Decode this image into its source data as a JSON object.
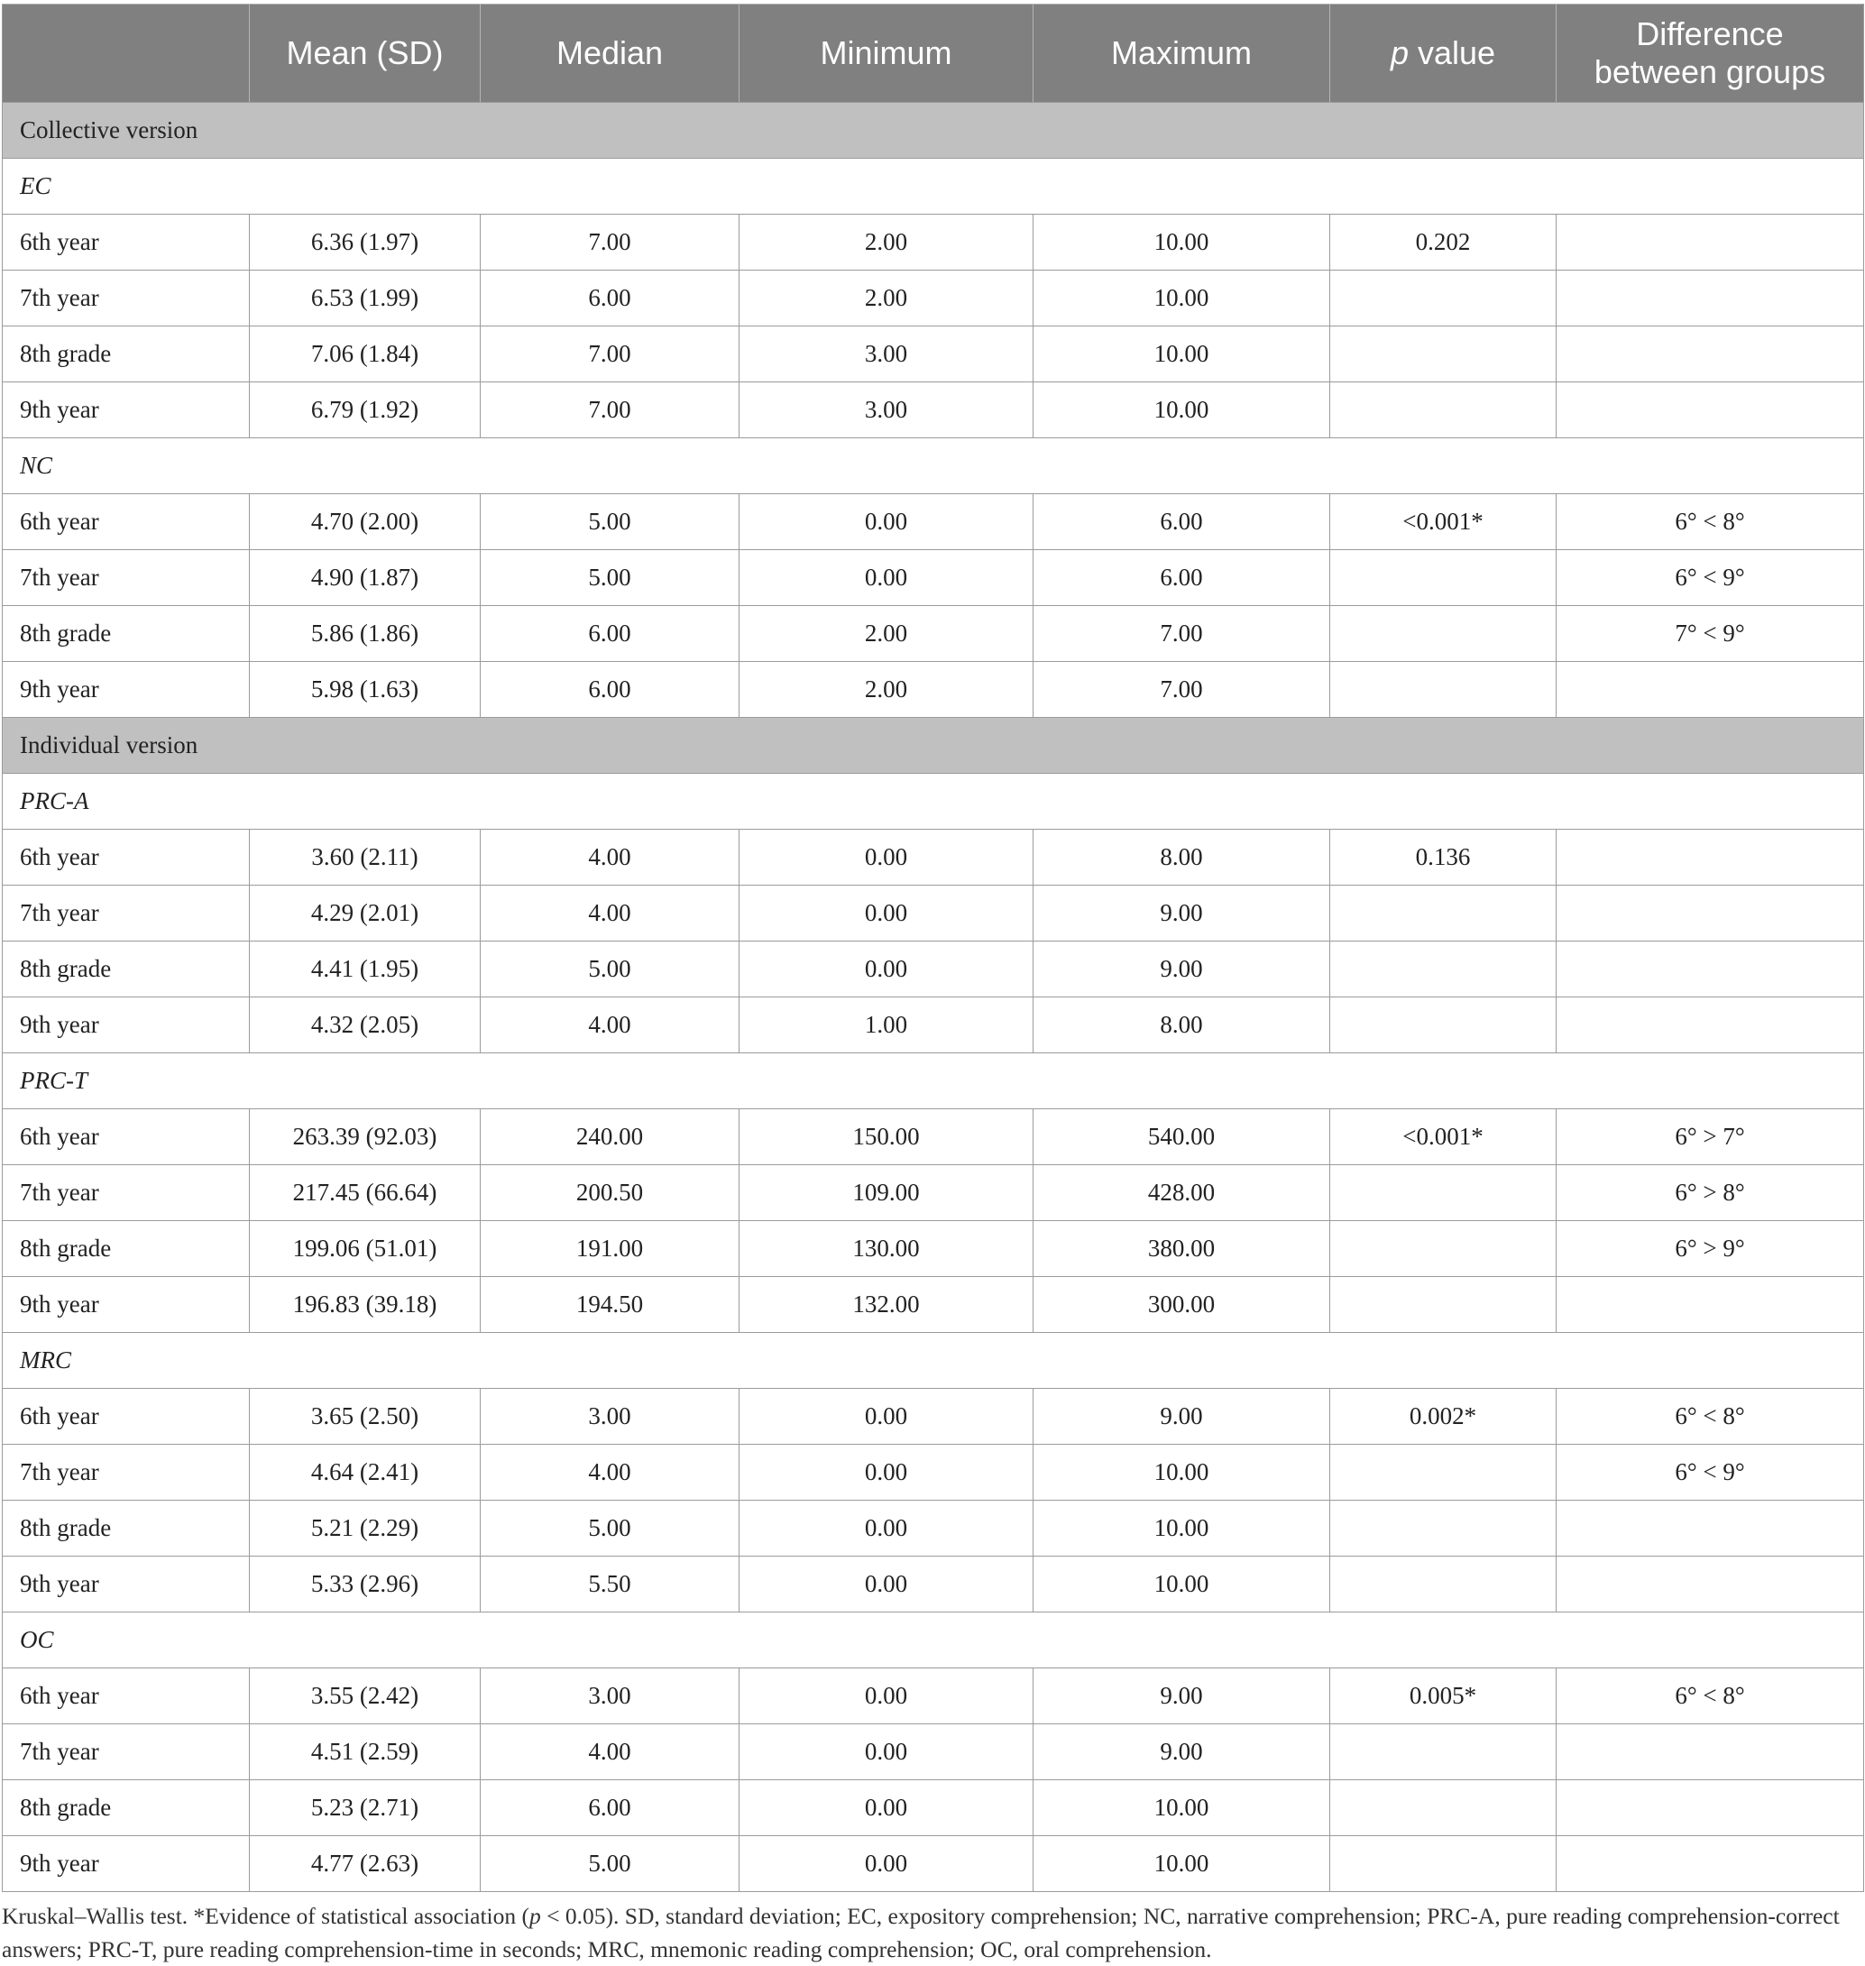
{
  "table": {
    "headers": [
      "",
      "Mean (SD)",
      "Median",
      "Minimum",
      "Maximum",
      "p value",
      "Difference between groups"
    ],
    "header_pvalue": {
      "italic": "p",
      "rest": " value"
    },
    "header_diff_lines": [
      "Difference",
      "between groups"
    ],
    "sections": [
      {
        "title": "Collective version",
        "groups": [
          {
            "name": "EC",
            "rows": [
              [
                "6th year",
                "6.36 (1.97)",
                "7.00",
                "2.00",
                "10.00",
                "0.202",
                ""
              ],
              [
                "7th year",
                "6.53 (1.99)",
                "6.00",
                "2.00",
                "10.00",
                "",
                ""
              ],
              [
                "8th grade",
                "7.06 (1.84)",
                "7.00",
                "3.00",
                "10.00",
                "",
                ""
              ],
              [
                "9th year",
                "6.79 (1.92)",
                "7.00",
                "3.00",
                "10.00",
                "",
                ""
              ]
            ]
          },
          {
            "name": "NC",
            "rows": [
              [
                "6th year",
                "4.70 (2.00)",
                "5.00",
                "0.00",
                "6.00",
                "<0.001*",
                "6° < 8°"
              ],
              [
                "7th year",
                "4.90 (1.87)",
                "5.00",
                "0.00",
                "6.00",
                "",
                "6° < 9°"
              ],
              [
                "8th grade",
                "5.86 (1.86)",
                "6.00",
                "2.00",
                "7.00",
                "",
                "7° < 9°"
              ],
              [
                "9th year",
                "5.98 (1.63)",
                "6.00",
                "2.00",
                "7.00",
                "",
                ""
              ]
            ]
          }
        ]
      },
      {
        "title": "Individual version",
        "groups": [
          {
            "name": "PRC-A",
            "rows": [
              [
                "6th year",
                "3.60 (2.11)",
                "4.00",
                "0.00",
                "8.00",
                "0.136",
                ""
              ],
              [
                "7th year",
                "4.29 (2.01)",
                "4.00",
                "0.00",
                "9.00",
                "",
                ""
              ],
              [
                "8th grade",
                "4.41 (1.95)",
                "5.00",
                "0.00",
                "9.00",
                "",
                ""
              ],
              [
                "9th year",
                "4.32 (2.05)",
                "4.00",
                "1.00",
                "8.00",
                "",
                ""
              ]
            ]
          },
          {
            "name": "PRC-T",
            "rows": [
              [
                "6th year",
                "263.39 (92.03)",
                "240.00",
                "150.00",
                "540.00",
                "<0.001*",
                "6° > 7°"
              ],
              [
                "7th year",
                "217.45 (66.64)",
                "200.50",
                "109.00",
                "428.00",
                "",
                "6° > 8°"
              ],
              [
                "8th grade",
                "199.06 (51.01)",
                "191.00",
                "130.00",
                "380.00",
                "",
                "6° > 9°"
              ],
              [
                "9th year",
                "196.83 (39.18)",
                "194.50",
                "132.00",
                "300.00",
                "",
                ""
              ]
            ]
          },
          {
            "name": "MRC",
            "rows": [
              [
                "6th year",
                "3.65 (2.50)",
                "3.00",
                "0.00",
                "9.00",
                "0.002*",
                "6° < 8°"
              ],
              [
                "7th year",
                "4.64 (2.41)",
                "4.00",
                "0.00",
                "10.00",
                "",
                "6° < 9°"
              ],
              [
                "8th grade",
                "5.21 (2.29)",
                "5.00",
                "0.00",
                "10.00",
                "",
                ""
              ],
              [
                "9th year",
                "5.33 (2.96)",
                "5.50",
                "0.00",
                "10.00",
                "",
                ""
              ]
            ]
          },
          {
            "name": "OC",
            "rows": [
              [
                "6th year",
                "3.55 (2.42)",
                "3.00",
                "0.00",
                "9.00",
                "0.005*",
                "6° < 8°"
              ],
              [
                "7th year",
                "4.51 (2.59)",
                "4.00",
                "0.00",
                "9.00",
                "",
                ""
              ],
              [
                "8th grade",
                "5.23 (2.71)",
                "6.00",
                "0.00",
                "10.00",
                "",
                ""
              ],
              [
                "9th year",
                "4.77 (2.63)",
                "5.00",
                "0.00",
                "10.00",
                "",
                ""
              ]
            ]
          }
        ]
      }
    ]
  },
  "footnote": {
    "part1": "Kruskal–Wallis test. *Evidence of statistical association (",
    "p_italic": "p",
    "part2": " < 0.05). SD, standard deviation; EC, expository comprehension; NC, narrative comprehension; PRC-A, pure reading comprehension-correct answers; PRC-T, pure reading comprehension-time in seconds; MRC, mnemonic reading comprehension; OC, oral comprehension."
  }
}
